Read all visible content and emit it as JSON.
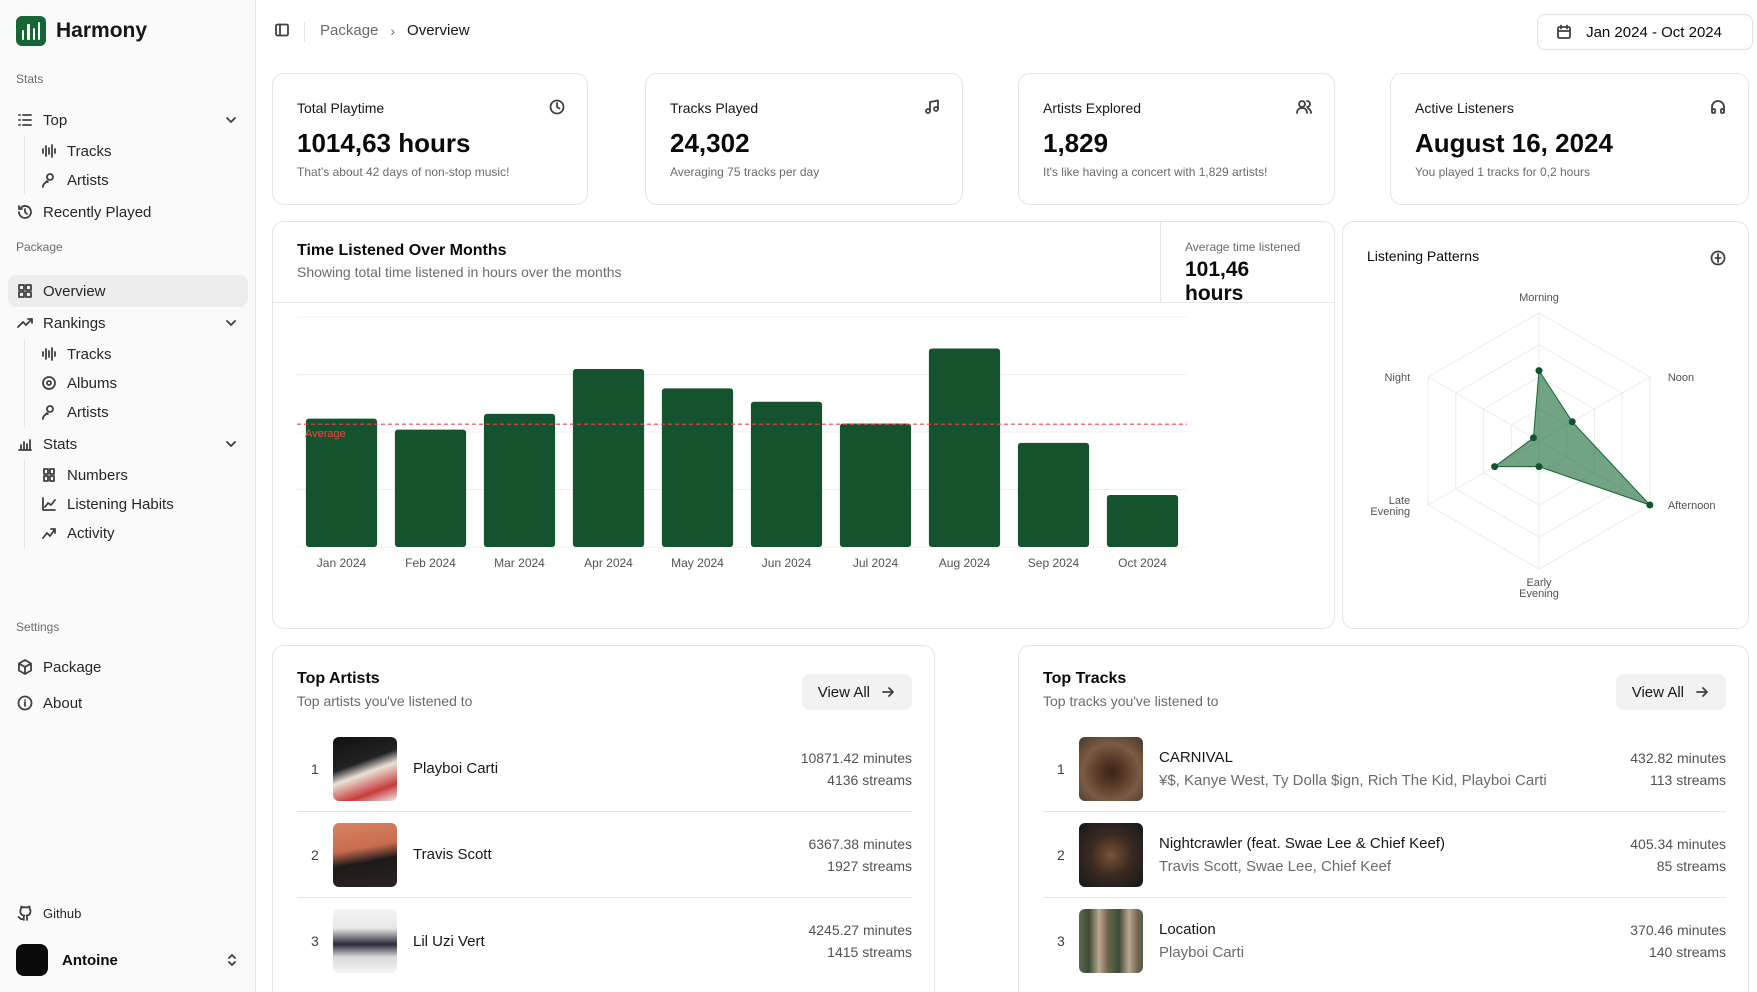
{
  "app": {
    "name": "Harmony"
  },
  "sidebar": {
    "stats_label": "Stats",
    "top": {
      "label": "Top",
      "items": [
        {
          "label": "Tracks"
        },
        {
          "label": "Artists"
        }
      ]
    },
    "recently_played": "Recently Played",
    "package_label": "Package",
    "overview": "Overview",
    "rankings": {
      "label": "Rankings",
      "items": [
        {
          "label": "Tracks"
        },
        {
          "label": "Albums"
        },
        {
          "label": "Artists"
        }
      ]
    },
    "stats": {
      "label": "Stats",
      "items": [
        {
          "label": "Numbers"
        },
        {
          "label": "Listening Habits"
        },
        {
          "label": "Activity"
        }
      ]
    },
    "settings_label": "Settings",
    "settings_package": "Package",
    "about": "About",
    "github": "Github",
    "user": "Antoine"
  },
  "breadcrumb": {
    "parent": "Package",
    "current": "Overview"
  },
  "date_range": "Jan 2024 - Oct 2024",
  "stats_cards": [
    {
      "title": "Total Playtime",
      "value": "1014,63 hours",
      "sub": "That's about 42 days of non-stop music!",
      "icon": "clock-icon"
    },
    {
      "title": "Tracks Played",
      "value": "24,302",
      "sub": "Averaging 75 tracks per day",
      "icon": "music-icon"
    },
    {
      "title": "Artists Explored",
      "value": "1,829",
      "sub": "It's like having a concert with 1,829 artists!",
      "icon": "users-icon"
    },
    {
      "title": "Active Listeners",
      "value": "August 16, 2024",
      "sub": "You played 1 tracks for 0,2 hours",
      "icon": "headphones-icon"
    }
  ],
  "time_chart": {
    "title": "Time Listened Over Months",
    "subtitle": "Showing total time listened in hours over the months",
    "avg_label": "Average time listened",
    "avg_value": "101,46 hours"
  },
  "chart_data": [
    {
      "type": "bar",
      "categories": [
        "Jan 2024",
        "Feb 2024",
        "Mar 2024",
        "Apr 2024",
        "May 2024",
        "Jun 2024",
        "Jul 2024",
        "Aug 2024",
        "Sep 2024",
        "Oct 2024"
      ],
      "values": [
        106,
        97,
        110,
        147,
        131,
        120,
        102,
        164,
        86,
        43
      ],
      "average": 101.46,
      "average_label": "Average",
      "ylim": [
        0,
        190
      ],
      "color": "#14532d",
      "average_color": "#ef4444",
      "grid": true
    },
    {
      "type": "radar",
      "title": "Listening Patterns",
      "axes": [
        "Morning",
        "Noon",
        "Afternoon",
        "Early Evening",
        "Late Evening",
        "Night"
      ],
      "values": [
        0.55,
        0.3,
        1.0,
        0.2,
        0.4,
        0.05
      ],
      "rings": 4,
      "color": "#166534"
    }
  ],
  "top_artists": {
    "title": "Top Artists",
    "subtitle": "Top artists you've listened to",
    "view_all": "View All",
    "rows": [
      {
        "rank": "1",
        "name": "Playboi Carti",
        "minutes": "10871.42 minutes",
        "streams": "4136 streams"
      },
      {
        "rank": "2",
        "name": "Travis Scott",
        "minutes": "6367.38 minutes",
        "streams": "1927 streams"
      },
      {
        "rank": "3",
        "name": "Lil Uzi Vert",
        "minutes": "4245.27 minutes",
        "streams": "1415 streams"
      }
    ]
  },
  "top_tracks": {
    "title": "Top Tracks",
    "subtitle": "Top tracks you've listened to",
    "view_all": "View All",
    "rows": [
      {
        "rank": "1",
        "name": "CARNIVAL",
        "artists": "¥$, Kanye West, Ty Dolla $ign, Rich The Kid, Playboi Carti",
        "minutes": "432.82 minutes",
        "streams": "113 streams"
      },
      {
        "rank": "2",
        "name": "Nightcrawler (feat. Swae Lee & Chief Keef)",
        "artists": "Travis Scott, Swae Lee, Chief Keef",
        "minutes": "405.34 minutes",
        "streams": "85 streams"
      },
      {
        "rank": "3",
        "name": "Location",
        "artists": "Playboi Carti",
        "minutes": "370.46 minutes",
        "streams": "140 streams"
      }
    ]
  }
}
